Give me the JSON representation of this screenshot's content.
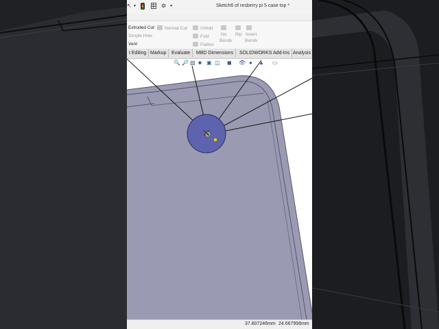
{
  "window": {
    "title": "Sketch6 of resberry pi 5 case top *"
  },
  "quick_access": {
    "select_icon": "cursor-arrow",
    "dropdown_icon": "chevron-down",
    "traffic_icon": "traffic-light",
    "table_icon": "table",
    "options_icon": "gear"
  },
  "ribbon": {
    "extruded_cut": "Extruded Cut",
    "normal_cut": "Normal Cut",
    "simple_hole": "Simple Hole",
    "vent": "Vent",
    "unfold": "Unfold",
    "fold": "Fold",
    "flatten": "Flatten",
    "no_bends_1": "No",
    "no_bends_2": "Bends",
    "rip": "Rip",
    "insert_bends_1": "Insert",
    "insert_bends_2": "Bends"
  },
  "tabs": [
    {
      "label": "t Editing"
    },
    {
      "label": "Markup"
    },
    {
      "label": "Evaluate"
    },
    {
      "label": "MBD Dimensions"
    },
    {
      "label": "SOLIDWORKS Add-Ins"
    },
    {
      "label": "Analysis"
    }
  ],
  "status_bar": {
    "x_coord": "37.807246mm",
    "y_coord": "24.667996mm"
  },
  "colors": {
    "part_fill": "#9a9bb2",
    "hole_fill": "#5d63ad",
    "sketch_line": "#111111",
    "endpoint_marker": "#e8d21a",
    "dark_background": "#1b1c1f"
  }
}
